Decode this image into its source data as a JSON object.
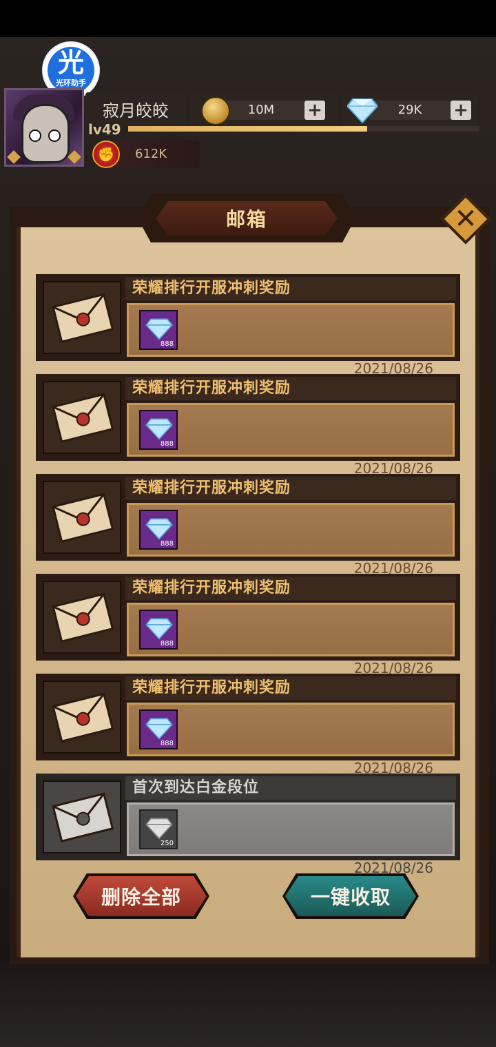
{
  "assistant": {
    "glyph": "光",
    "label": "光环助手"
  },
  "player": {
    "name": "寂月皎皎",
    "level": "lv49",
    "xp_fraction": 0.68,
    "power": "612K"
  },
  "currencies": {
    "gold": {
      "value": "10M",
      "icon": "coin-icon"
    },
    "diamond": {
      "value": "29K",
      "icon": "diamond-icon"
    },
    "plus_glyph": "+"
  },
  "mailbox": {
    "title": "邮箱",
    "close_glyph": "✕",
    "items": [
      {
        "title": "荣耀排行开服冲刺奖励",
        "reward_count": "888",
        "date": "2021/08/26",
        "read": false
      },
      {
        "title": "荣耀排行开服冲刺奖励",
        "reward_count": "888",
        "date": "2021/08/26",
        "read": false
      },
      {
        "title": "荣耀排行开服冲刺奖励",
        "reward_count": "888",
        "date": "2021/08/26",
        "read": false
      },
      {
        "title": "荣耀排行开服冲刺奖励",
        "reward_count": "888",
        "date": "2021/08/26",
        "read": false
      },
      {
        "title": "荣耀排行开服冲刺奖励",
        "reward_count": "888",
        "date": "2021/08/26",
        "read": false
      },
      {
        "title": "首次到达白金段位",
        "reward_count": "250",
        "date": "2021/08/26",
        "read": true
      }
    ]
  },
  "buttons": {
    "delete_all": "删除全部",
    "collect_all": "一键收取"
  },
  "colors": {
    "accent_gold": "#f0c070",
    "delete_button": "#c04a3a",
    "collect_button": "#2a8a88"
  }
}
